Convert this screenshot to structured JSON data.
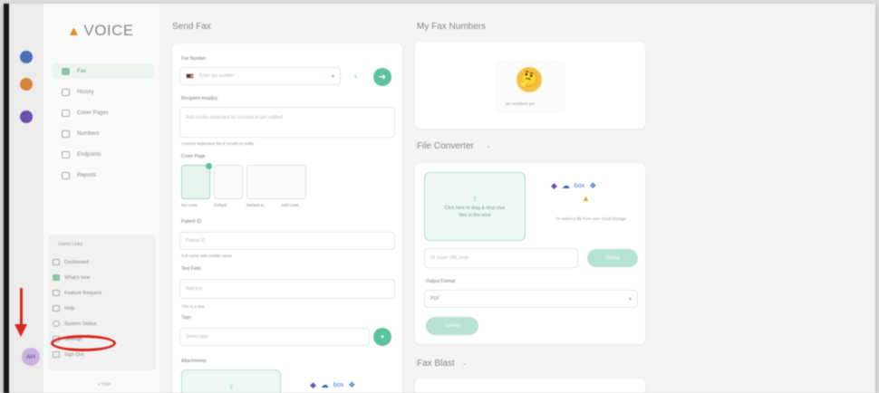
{
  "app": {
    "logo": "VOICE",
    "user_initials": "AH"
  },
  "nav": {
    "items": [
      {
        "label": "Fax"
      },
      {
        "label": "History"
      },
      {
        "label": "Cover Pages"
      },
      {
        "label": "Numbers"
      },
      {
        "label": "Endpoints"
      },
      {
        "label": "Reports"
      }
    ]
  },
  "footer": {
    "title": "Useful Links",
    "items": [
      {
        "label": "Dashboard"
      },
      {
        "label": "What's new"
      },
      {
        "label": "Feature Request"
      },
      {
        "label": "Help"
      },
      {
        "label": "System Status"
      },
      {
        "label": "Settings"
      },
      {
        "label": "Sign Out"
      }
    ],
    "collapse_label": "« Hide"
  },
  "send_fax": {
    "title": "Send Fax",
    "fax_number_label": "Fax Number",
    "fax_number_placeholder": "Enter fax number",
    "recipient_label": "Recipient email(s)",
    "recipient_placeholder": "Add emails separated by commas to get notified",
    "recipient_help": "Comma separated list of emails to notify",
    "cover_page_label": "Cover Page",
    "cover_pages": [
      {
        "label": "No cover"
      },
      {
        "label": "Default"
      },
      {
        "label": "Default w..."
      },
      {
        "label": "Add Cove..."
      }
    ],
    "patient_label": "Patient ID",
    "patient_placeholder": "Patient ID",
    "patient_help": "Full name with middle name",
    "text_field_label": "Text Field",
    "text_field_placeholder": "Add text",
    "text_field_help": "This is a text",
    "tags_label": "Tags",
    "tags_placeholder": "Select tags",
    "attachments_label": "Attachments"
  },
  "my_fax_numbers": {
    "title": "My Fax Numbers",
    "empty_text": "No numbers yet"
  },
  "file_converter": {
    "title": "File Converter",
    "drop_text": "Click here or drag & drop your files in this area",
    "cloud_text": "Or select a file from your cloud storage",
    "url_placeholder": "Or paste URL here",
    "url_button": "Upload",
    "output_label": "Output Format",
    "output_value": "PDF",
    "convert_button": "Convert"
  },
  "fax_blast": {
    "title": "Fax Blast"
  },
  "colors": {
    "accent": "#5cc29a",
    "annotation": "#d8281e"
  }
}
